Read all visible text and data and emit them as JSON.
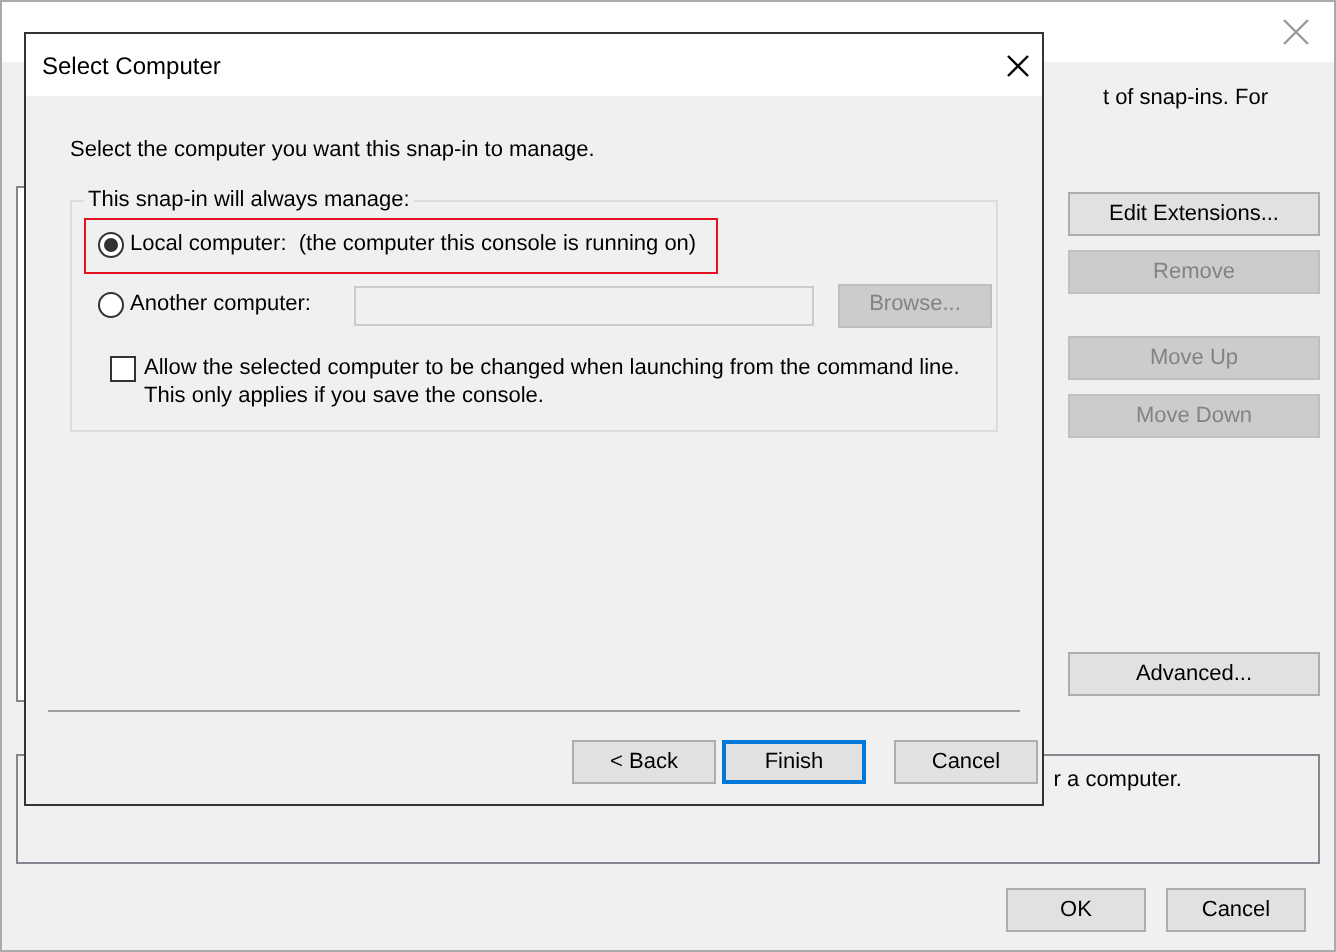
{
  "background_window": {
    "description_fragment": "t of snap-ins. For",
    "buttons": [
      {
        "label": "Edit Extensions...",
        "disabled": false
      },
      {
        "label": "Remove",
        "disabled": true
      },
      {
        "label": "Move Up",
        "disabled": true
      },
      {
        "label": "Move Down",
        "disabled": true
      },
      {
        "label": "Advanced...",
        "disabled": false
      }
    ],
    "help_fragment": "r a computer.",
    "footer_buttons": [
      "OK",
      "Cancel"
    ]
  },
  "dialog": {
    "title": "Select Computer",
    "prompt": "Select the computer you want this snap-in to manage.",
    "group_label": "This snap-in will always manage:",
    "options": [
      {
        "label": "Local computer:  (the computer this console is running on)",
        "selected": true,
        "highlighted": true
      },
      {
        "label": "Another computer:",
        "selected": false,
        "highlighted": false
      }
    ],
    "computer_field": {
      "disabled": true
    },
    "browse_button": {
      "label": "Browse...",
      "disabled": true
    },
    "allow_change": {
      "label": "Allow the selected computer to be changed when launching from the command line.  This only applies if you save the console.",
      "checked": false
    },
    "buttons": [
      {
        "label": "< Back",
        "default": false
      },
      {
        "label": "Finish",
        "default": true
      },
      {
        "label": "Cancel",
        "default": false
      }
    ]
  }
}
